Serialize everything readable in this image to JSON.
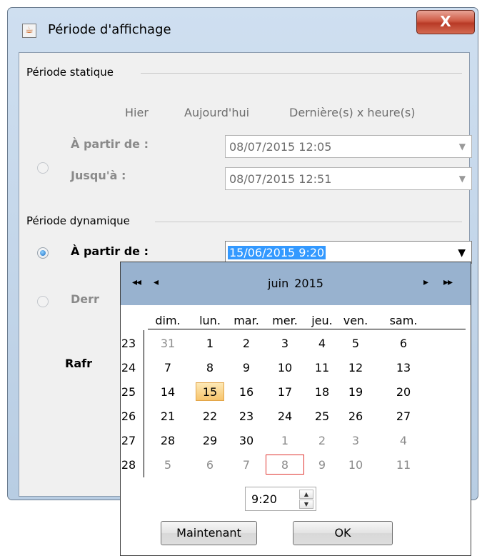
{
  "window": {
    "title": "Période d'affichage",
    "icon": "java-icon",
    "close_label": "X"
  },
  "static_period": {
    "title": "Période statique",
    "columns": [
      "Hier",
      "Aujourd'hui",
      "Dernière(s) x heure(s)"
    ],
    "from_label": "À partir de :",
    "from_value": "08/07/2015 12:05",
    "to_label": "Jusqu'à :",
    "to_value": "08/07/2015 12:51"
  },
  "dynamic_period": {
    "title": "Période dynamique",
    "from_label": "À partir de :",
    "from_value": "15/06/2015 9:20",
    "last_label": "Derr",
    "refresh_label": "Rafr"
  },
  "calendar": {
    "month": "juin",
    "year": "2015",
    "nav_prev_year": "◂◂",
    "nav_prev_month": "◂",
    "nav_next_month": "▸",
    "nav_next_year": "▸▸",
    "days_of_week": [
      "dim.",
      "lun.",
      "mar.",
      "mer.",
      "jeu.",
      "ven.",
      "sam."
    ],
    "weeks": [
      {
        "num": "23",
        "days": [
          "31",
          "1",
          "2",
          "3",
          "4",
          "5",
          "6"
        ],
        "muted": [
          true,
          false,
          false,
          false,
          false,
          false,
          false
        ]
      },
      {
        "num": "24",
        "days": [
          "7",
          "8",
          "9",
          "10",
          "11",
          "12",
          "13"
        ],
        "muted": [
          false,
          false,
          false,
          false,
          false,
          false,
          false
        ]
      },
      {
        "num": "25",
        "days": [
          "14",
          "15",
          "16",
          "17",
          "18",
          "19",
          "20"
        ],
        "muted": [
          false,
          false,
          false,
          false,
          false,
          false,
          false
        ]
      },
      {
        "num": "26",
        "days": [
          "21",
          "22",
          "23",
          "24",
          "25",
          "26",
          "27"
        ],
        "muted": [
          false,
          false,
          false,
          false,
          false,
          false,
          false
        ]
      },
      {
        "num": "27",
        "days": [
          "28",
          "29",
          "30",
          "1",
          "2",
          "3",
          "4"
        ],
        "muted": [
          false,
          false,
          false,
          true,
          true,
          true,
          true
        ]
      },
      {
        "num": "28",
        "days": [
          "5",
          "6",
          "7",
          "8",
          "9",
          "10",
          "11"
        ],
        "muted": [
          true,
          true,
          true,
          true,
          true,
          true,
          true
        ]
      }
    ],
    "selected_day": "15",
    "today_day": "8",
    "time_value": "9:20",
    "now_button": "Maintenant",
    "ok_button": "OK",
    "colors": {
      "header": "#98b2cf",
      "selected": "#f7c46c",
      "today_border": "#e0332f"
    }
  }
}
